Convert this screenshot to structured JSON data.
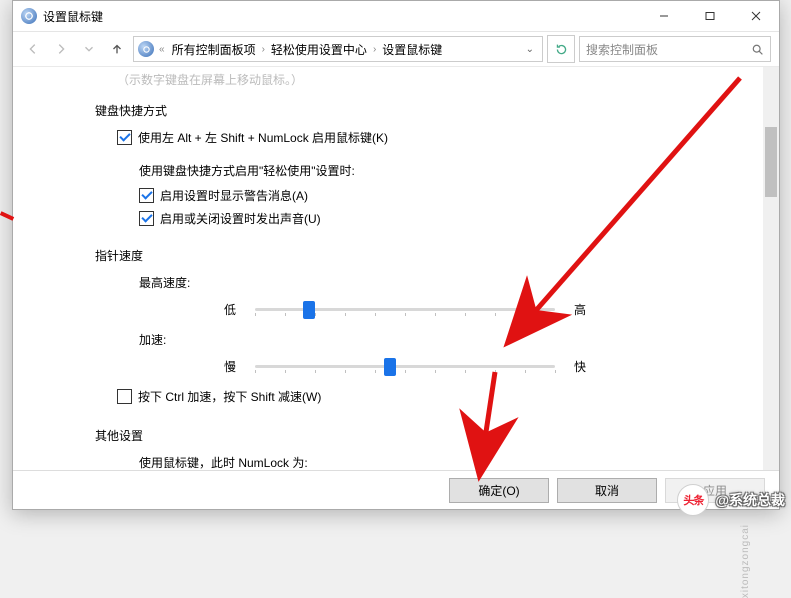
{
  "window": {
    "title": "设置鼠标键"
  },
  "breadcrumb": {
    "prefix": "«",
    "items": [
      "所有控制面板项",
      "轻松使用设置中心",
      "设置鼠标键"
    ]
  },
  "search": {
    "placeholder": "搜索控制面板"
  },
  "cutoff_hint": "（示数字键盘在屏幕上移动鼠标。）",
  "sections": {
    "shortcut": {
      "title": "键盘快捷方式",
      "enable": {
        "checked": true,
        "label": "使用左 Alt + 左 Shift + NumLock 启用鼠标键(K)"
      },
      "sub_title": "使用键盘快捷方式启用\"轻松使用\"设置时:",
      "warn": {
        "checked": true,
        "label": "启用设置时显示警告消息(A)"
      },
      "sound": {
        "checked": true,
        "label": "启用或关闭设置时发出声音(U)"
      }
    },
    "pointer": {
      "title": "指针速度",
      "top_speed": {
        "label": "最高速度:",
        "low": "低",
        "high": "高",
        "value_pct": 18
      },
      "accel": {
        "label": "加速:",
        "low": "慢",
        "high": "快",
        "value_pct": 45
      },
      "ctrl_shift": {
        "checked": false,
        "label": "按下 Ctrl 加速，按下 Shift 减速(W)"
      }
    },
    "other": {
      "title": "其他设置",
      "numlock_label": "使用鼠标键，此时 NumLock 为:"
    }
  },
  "buttons": {
    "ok": "确定(O)",
    "cancel": "取消",
    "apply": "应用"
  },
  "watermark": {
    "badge": "头条",
    "text": "@系统总裁",
    "side": "xitongzongcai"
  }
}
